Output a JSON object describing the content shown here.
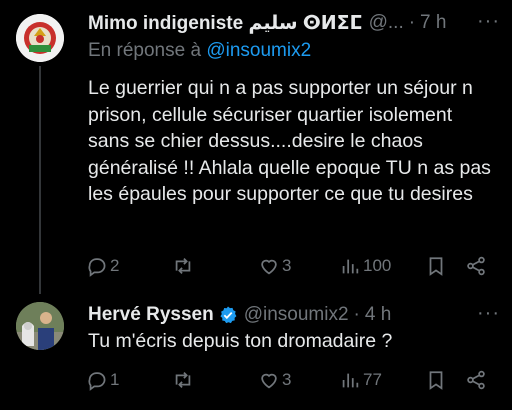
{
  "tweets": [
    {
      "author_name": "Mimo indigeniste سليم ⵙⵍⵉⵎ",
      "handle": "@...",
      "separator": "·",
      "time": "7 h",
      "more": "···",
      "reply_prefix": "En réponse à ",
      "reply_handle": "@insoumix2",
      "text": "Le guerrier qui n a pas supporter un séjour n prison, cellule sécuriser quartier isolement sans se chier dessus....desire le chaos généralisé !! Ahlala quelle epoque TU n as pas les épaules pour supporter ce que tu desires",
      "replies": "2",
      "retweets": "",
      "likes": "3",
      "views": "100"
    },
    {
      "author_name": "Hervé Ryssen",
      "verified": true,
      "handle": "@insoumix2",
      "separator": "·",
      "time": "4 h",
      "more": "···",
      "text": "Tu m'écris depuis ton dromadaire ?",
      "replies": "1",
      "retweets": "",
      "likes": "3",
      "views": "77"
    }
  ],
  "icons": {
    "reply": "reply-icon",
    "retweet": "retweet-icon",
    "like": "heart-icon",
    "views": "views-icon",
    "bookmark": "bookmark-icon",
    "share": "share-icon",
    "verified": "verified-badge-icon"
  },
  "colors": {
    "background": "#000000",
    "text": "#e7e9ea",
    "muted": "#71767b",
    "link": "#1d9bf0",
    "thread_line": "#333639"
  }
}
